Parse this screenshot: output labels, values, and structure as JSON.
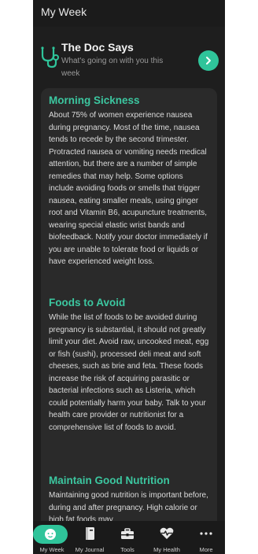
{
  "header": {
    "title": "My Week"
  },
  "doc_banner": {
    "title": "The Doc Says",
    "subtitle": "What's going on with you this week"
  },
  "article": {
    "sections": [
      {
        "title": "Morning Sickness",
        "body": "About 75% of women experience nausea during pregnancy. Most of the time, nausea tends to recede by the second trimester. Protracted nausea or vomiting needs medical attention, but there are a number of simple remedies that may help. Some options include avoiding foods or smells that trigger nausea, eating smaller meals, using ginger root and Vitamin B6, acupuncture treatments, wearing special elastic wrist bands and biofeedback. Notify your doctor immediately if you are unable to tolerate food or liquids or have experienced weight loss."
      },
      {
        "title": "Foods to Avoid",
        "body": "While the list of foods to be avoided during pregnancy is substantial, it should not greatly limit your diet. Avoid raw, uncooked meat, egg or fish (sushi), processed deli meat and soft cheeses, such as brie and feta. These foods increase the risk of acquiring parasitic or bacterial infections such as Listeria, which could potentially harm your baby. Talk to your health care provider or nutritionist for a comprehensive list of foods to avoid."
      },
      {
        "title": "Maintain Good Nutrition",
        "body": "Maintaining good nutrition is important before, during and after pregnancy. High calorie or high fat foods may"
      }
    ]
  },
  "bottom_nav": {
    "items": [
      {
        "label": "My Week",
        "icon": "baby-face-icon",
        "active": true
      },
      {
        "label": "My Journal",
        "icon": "journal-icon",
        "active": false
      },
      {
        "label": "Tools",
        "icon": "toolbox-icon",
        "active": false
      },
      {
        "label": "My Health",
        "icon": "heart-pulse-icon",
        "active": false
      },
      {
        "label": "More",
        "icon": "more-dots-icon",
        "active": false
      }
    ]
  },
  "colors": {
    "accent": "#2fc49a",
    "heading": "#3cc7a0",
    "background": "#1e1e1e",
    "card": "#2a2a2a"
  }
}
